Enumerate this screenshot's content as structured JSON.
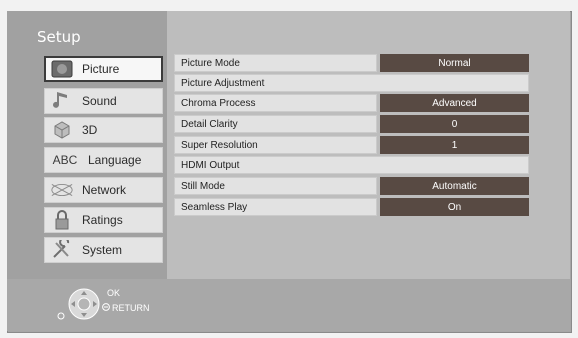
{
  "screen": {
    "title": "Setup"
  },
  "sidebar": {
    "items": [
      {
        "label": "Picture",
        "icon": "picture-icon",
        "selected": true
      },
      {
        "label": "Sound",
        "icon": "sound-icon",
        "selected": false
      },
      {
        "label": "3D",
        "icon": "3d-icon",
        "selected": false
      },
      {
        "label": "Language",
        "icon": "abc-icon",
        "icon_text": "ABC",
        "selected": false
      },
      {
        "label": "Network",
        "icon": "network-icon",
        "selected": false
      },
      {
        "label": "Ratings",
        "icon": "lock-icon",
        "selected": false
      },
      {
        "label": "System",
        "icon": "tools-icon",
        "selected": false
      }
    ]
  },
  "settings": {
    "rows": [
      {
        "label": "Picture Mode",
        "value": "Normal"
      },
      {
        "label": "Picture Adjustment",
        "value": ""
      },
      {
        "label": "Chroma Process",
        "value": "Advanced"
      },
      {
        "label": "Detail Clarity",
        "value": "0"
      },
      {
        "label": "Super Resolution",
        "value": "1"
      },
      {
        "label": "HDMI Output",
        "value": ""
      },
      {
        "label": "Still Mode",
        "value": "Automatic"
      },
      {
        "label": "Seamless Play",
        "value": "On"
      }
    ]
  },
  "hints": {
    "ok_label": "OK",
    "return_label": "RETURN"
  },
  "colors": {
    "value_bg": "#584a43",
    "panel_bg": "#bdbdbd",
    "sidebar_bg": "#a1a1a1"
  }
}
